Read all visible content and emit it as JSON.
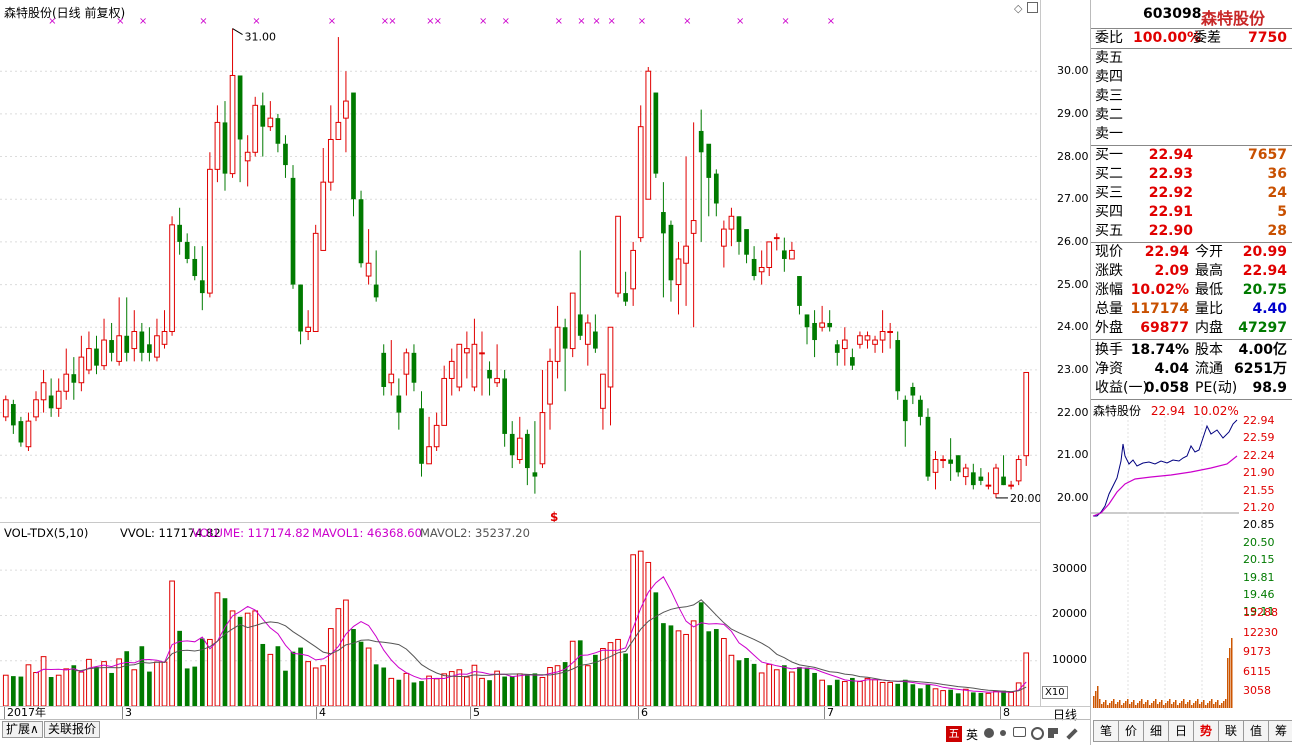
{
  "chart_title": "森特股份(日线 前复权)",
  "volume_title": {
    "name": "VOL-TDX(5,10)",
    "vvol": "VVOL: 117174.82",
    "volume": "VOLUME: 117174.82",
    "mavol1": "MAVOL1: 46368.60",
    "mavol2": "MAVOL2: 35237.20"
  },
  "colors": {
    "up": "#e00000",
    "down": "#007a00",
    "ma1": "#cc00cc",
    "ma2": "#555555"
  },
  "price_axis": [
    "30.00",
    "29.00",
    "28.00",
    "27.00",
    "26.00",
    "25.00",
    "24.00",
    "23.00",
    "22.00",
    "21.00",
    "20.00"
  ],
  "vol_axis": [
    "30000",
    "20000",
    "10000"
  ],
  "vol_axis_unit": "X10",
  "annotations": {
    "high": "31.00",
    "low": "20.00",
    "marker": "$"
  },
  "x_labels": [
    "2017年",
    "3",
    "4",
    "5",
    "6",
    "7",
    "8"
  ],
  "period_label": "日线",
  "bottom_tabs": [
    "扩展∧",
    "关联报价"
  ],
  "stock": {
    "code": "603098",
    "name": "森特股份"
  },
  "quote": {
    "webi_label": "委比",
    "webi": "100.00%",
    "weicha_label": "委差",
    "weicha": "7750",
    "sell": [
      {
        "label": "卖五",
        "price": "",
        "vol": ""
      },
      {
        "label": "卖四",
        "price": "",
        "vol": ""
      },
      {
        "label": "卖三",
        "price": "",
        "vol": ""
      },
      {
        "label": "卖二",
        "price": "",
        "vol": ""
      },
      {
        "label": "卖一",
        "price": "",
        "vol": ""
      }
    ],
    "buy": [
      {
        "label": "买一",
        "price": "22.94",
        "vol": "7657"
      },
      {
        "label": "买二",
        "price": "22.93",
        "vol": "36"
      },
      {
        "label": "买三",
        "price": "22.92",
        "vol": "24"
      },
      {
        "label": "买四",
        "price": "22.91",
        "vol": "5"
      },
      {
        "label": "买五",
        "price": "22.90",
        "vol": "28"
      }
    ],
    "stats": [
      {
        "l1": "现价",
        "v1": "22.94",
        "c1": "red",
        "l2": "今开",
        "v2": "20.99",
        "c2": "red"
      },
      {
        "l1": "涨跌",
        "v1": "2.09",
        "c1": "red",
        "l2": "最高",
        "v2": "22.94",
        "c2": "red"
      },
      {
        "l1": "涨幅",
        "v1": "10.02%",
        "c1": "red",
        "l2": "最低",
        "v2": "20.75",
        "c2": "green"
      },
      {
        "l1": "总量",
        "v1": "117174",
        "c1": "orange",
        "l2": "量比",
        "v2": "4.40",
        "c2": "blue"
      },
      {
        "l1": "外盘",
        "v1": "69877",
        "c1": "red",
        "l2": "内盘",
        "v2": "47297",
        "c2": "green"
      }
    ],
    "fund": [
      {
        "l1": "换手",
        "v1": "18.74%",
        "l2": "股本",
        "v2": "4.00亿"
      },
      {
        "l1": "净资",
        "v1": "4.04",
        "l2": "流通",
        "v2": "6251万"
      },
      {
        "l1": "收益(一)",
        "v1": "0.058",
        "l2": "PE(动)",
        "v2": "98.9"
      }
    ]
  },
  "intraday": {
    "title_name": "森特股份",
    "title_price": "22.94",
    "title_pct": "10.02%",
    "price_labels": [
      "22.94",
      "22.59",
      "22.24",
      "21.90",
      "21.55",
      "21.20",
      "20.85",
      "20.50",
      "20.15",
      "19.81",
      "19.46",
      "19.11"
    ],
    "vol_labels": [
      "15288",
      "12230",
      "9173",
      "6115",
      "3058"
    ]
  },
  "right_tabs": [
    "笔",
    "价",
    "细",
    "日",
    "势",
    "联",
    "值",
    "筹"
  ],
  "tray_icons": [
    "五",
    "英"
  ],
  "chart_data": {
    "type": "candlestick",
    "ylim": [
      19.6,
      31.2
    ],
    "vol_ylim": [
      0,
      36000
    ],
    "candles": [
      [
        21.9,
        22.3,
        22.4,
        21.8,
        6800
      ],
      [
        22.2,
        21.7,
        22.3,
        21.5,
        6600
      ],
      [
        21.8,
        21.3,
        21.9,
        21.2,
        6500
      ],
      [
        21.2,
        21.8,
        22.0,
        21.1,
        9100
      ],
      [
        21.9,
        22.3,
        22.5,
        21.8,
        7400
      ],
      [
        22.3,
        22.7,
        23.0,
        22.0,
        10900
      ],
      [
        22.4,
        22.1,
        22.8,
        21.9,
        6400
      ],
      [
        22.1,
        22.5,
        22.8,
        21.9,
        6800
      ],
      [
        22.5,
        22.9,
        23.5,
        22.3,
        8200
      ],
      [
        22.9,
        22.7,
        23.3,
        22.3,
        9000
      ],
      [
        22.7,
        23.3,
        23.8,
        22.5,
        7500
      ],
      [
        23.0,
        23.5,
        23.9,
        22.9,
        10300
      ],
      [
        23.5,
        23.1,
        23.8,
        22.9,
        8600
      ],
      [
        23.1,
        23.7,
        24.2,
        23.0,
        9800
      ],
      [
        23.7,
        23.4,
        24.1,
        23.2,
        7300
      ],
      [
        23.2,
        23.8,
        24.7,
        23.1,
        10400
      ],
      [
        23.8,
        23.4,
        24.7,
        23.2,
        12100
      ],
      [
        23.5,
        23.9,
        24.4,
        23.2,
        8000
      ],
      [
        23.9,
        23.4,
        24.1,
        23.2,
        13200
      ],
      [
        23.6,
        23.4,
        24.0,
        23.2,
        7600
      ],
      [
        23.3,
        23.8,
        24.2,
        23.2,
        9700
      ],
      [
        23.6,
        23.9,
        24.4,
        23.5,
        9700
      ],
      [
        23.9,
        26.4,
        26.6,
        23.8,
        27600
      ],
      [
        26.4,
        26.0,
        26.8,
        25.7,
        16600
      ],
      [
        26.0,
        25.6,
        26.2,
        25.5,
        8300
      ],
      [
        25.6,
        25.2,
        25.9,
        25.1,
        8700
      ],
      [
        25.1,
        24.8,
        25.9,
        24.4,
        14900
      ],
      [
        24.8,
        27.7,
        28.1,
        24.7,
        14700
      ],
      [
        27.7,
        28.8,
        29.2,
        27.4,
        25000
      ],
      [
        28.8,
        27.6,
        29.3,
        27.2,
        23800
      ],
      [
        27.6,
        29.9,
        31.0,
        27.5,
        21000
      ],
      [
        29.9,
        28.4,
        29.8,
        27.4,
        19700
      ],
      [
        27.9,
        28.1,
        28.5,
        27.3,
        20500
      ],
      [
        28.1,
        29.2,
        29.4,
        28.0,
        21000
      ],
      [
        29.2,
        28.7,
        29.5,
        28.0,
        13700
      ],
      [
        28.7,
        28.9,
        29.3,
        28.6,
        11400
      ],
      [
        28.9,
        28.3,
        29.0,
        28.1,
        13200
      ],
      [
        28.3,
        27.8,
        28.5,
        27.5,
        7800
      ],
      [
        27.5,
        25.0,
        27.8,
        24.9,
        12000
      ],
      [
        25.0,
        23.9,
        25.0,
        23.6,
        12900
      ],
      [
        23.9,
        24.0,
        24.4,
        23.7,
        9800
      ],
      [
        23.9,
        26.2,
        26.4,
        25.2,
        8400
      ],
      [
        25.8,
        27.4,
        28.2,
        26.3,
        8900
      ],
      [
        27.4,
        28.4,
        29.2,
        27.2,
        17100
      ],
      [
        28.4,
        28.8,
        30.8,
        28.4,
        21500
      ],
      [
        28.9,
        29.3,
        30.0,
        28.1,
        23400
      ],
      [
        29.5,
        27.0,
        29.4,
        26.6,
        17000
      ],
      [
        27.0,
        25.5,
        27.2,
        25.4,
        14200
      ],
      [
        25.2,
        25.5,
        26.3,
        25.0,
        12800
      ],
      [
        25.0,
        24.7,
        25.8,
        24.6,
        9200
      ],
      [
        23.4,
        22.6,
        23.6,
        22.4,
        8500
      ],
      [
        22.7,
        22.9,
        23.7,
        22.4,
        6100
      ],
      [
        22.4,
        22.0,
        22.8,
        21.6,
        5800
      ],
      [
        22.9,
        23.4,
        23.5,
        22.4,
        7200
      ],
      [
        23.4,
        22.7,
        23.6,
        22.5,
        5200
      ],
      [
        22.1,
        20.8,
        22.5,
        20.5,
        5500
      ],
      [
        20.8,
        21.2,
        21.9,
        20.9,
        6600
      ],
      [
        21.2,
        21.7,
        22.0,
        21.1,
        6000
      ],
      [
        21.7,
        22.8,
        23.1,
        21.7,
        7100
      ],
      [
        22.8,
        23.2,
        23.5,
        22.4,
        7600
      ],
      [
        22.6,
        23.6,
        23.6,
        22.5,
        8000
      ],
      [
        23.4,
        23.5,
        23.9,
        22.8,
        6400
      ],
      [
        22.6,
        23.6,
        24.2,
        22.5,
        9000
      ],
      [
        23.4,
        23.4,
        23.9,
        22.4,
        6100
      ],
      [
        23.0,
        22.8,
        23.2,
        22.4,
        5700
      ],
      [
        22.7,
        22.8,
        23.6,
        22.6,
        7700
      ],
      [
        22.8,
        21.5,
        23.0,
        21.2,
        6500
      ],
      [
        21.5,
        21.0,
        21.8,
        20.7,
        6500
      ],
      [
        20.9,
        21.4,
        21.9,
        20.8,
        7100
      ],
      [
        21.5,
        20.7,
        21.6,
        20.3,
        6800
      ],
      [
        20.6,
        20.5,
        21.8,
        20.1,
        7200
      ],
      [
        20.8,
        22.0,
        23.0,
        20.7,
        6300
      ],
      [
        22.2,
        23.2,
        23.5,
        21.6,
        8500
      ],
      [
        23.2,
        24.0,
        24.5,
        22.8,
        8900
      ],
      [
        24.0,
        23.5,
        24.2,
        22.5,
        9700
      ],
      [
        23.5,
        24.8,
        24.8,
        23.3,
        14300
      ],
      [
        24.3,
        23.8,
        25.8,
        23.7,
        14500
      ],
      [
        23.6,
        24.1,
        24.3,
        23.1,
        8900
      ],
      [
        23.9,
        23.5,
        24.3,
        23.4,
        11300
      ],
      [
        22.1,
        22.9,
        22.9,
        21.6,
        12700
      ],
      [
        22.6,
        24.0,
        24.0,
        21.7,
        14000
      ],
      [
        24.8,
        26.6,
        26.6,
        24.7,
        14700
      ],
      [
        24.8,
        24.6,
        25.3,
        24.5,
        11600
      ],
      [
        24.9,
        25.8,
        26.0,
        24.5,
        33400
      ],
      [
        26.1,
        28.7,
        29.2,
        26.0,
        34200
      ],
      [
        27.0,
        30.0,
        30.1,
        27.0,
        31700
      ],
      [
        29.5,
        27.6,
        29.5,
        27.5,
        25100
      ],
      [
        26.7,
        26.2,
        27.4,
        24.7,
        18300
      ],
      [
        26.4,
        25.1,
        26.5,
        24.6,
        17800
      ],
      [
        25.0,
        25.6,
        26.0,
        24.3,
        16600
      ],
      [
        25.5,
        25.9,
        28.0,
        24.5,
        15800
      ],
      [
        26.2,
        26.5,
        28.8,
        24.0,
        18800
      ],
      [
        28.6,
        28.1,
        29.1,
        26.0,
        22900
      ],
      [
        28.3,
        27.5,
        28.0,
        26.6,
        16500
      ],
      [
        27.6,
        26.9,
        27.7,
        26.6,
        17000
      ],
      [
        25.9,
        26.3,
        26.5,
        25.4,
        14900
      ],
      [
        26.3,
        26.6,
        26.8,
        25.9,
        11200
      ],
      [
        26.6,
        26.0,
        26.6,
        25.7,
        10100
      ],
      [
        26.3,
        25.7,
        26.2,
        25.5,
        10600
      ],
      [
        25.6,
        25.2,
        25.9,
        25.1,
        9300
      ],
      [
        25.3,
        25.4,
        25.8,
        25.0,
        7300
      ],
      [
        25.4,
        26.0,
        26.0,
        25.2,
        9200
      ],
      [
        26.1,
        26.1,
        26.2,
        25.8,
        8000
      ],
      [
        25.8,
        25.6,
        26.1,
        25.3,
        9000
      ],
      [
        25.6,
        25.8,
        26.0,
        25.6,
        7500
      ],
      [
        25.2,
        24.5,
        25.2,
        24.3,
        8600
      ],
      [
        24.3,
        24.0,
        24.3,
        23.6,
        8500
      ],
      [
        24.1,
        23.7,
        24.4,
        23.3,
        7300
      ],
      [
        24.0,
        24.1,
        24.5,
        23.9,
        5700
      ],
      [
        24.1,
        24.0,
        24.4,
        23.9,
        4600
      ],
      [
        23.6,
        23.4,
        23.7,
        23.1,
        5800
      ],
      [
        23.5,
        23.7,
        24.0,
        23.1,
        5400
      ],
      [
        23.3,
        23.1,
        23.5,
        23.0,
        6200
      ],
      [
        23.6,
        23.8,
        23.9,
        23.5,
        5400
      ],
      [
        23.7,
        23.8,
        23.9,
        23.5,
        6100
      ],
      [
        23.6,
        23.7,
        23.8,
        23.4,
        5800
      ],
      [
        23.7,
        23.9,
        24.4,
        23.4,
        5200
      ],
      [
        23.9,
        23.9,
        24.1,
        23.5,
        5200
      ],
      [
        23.7,
        22.5,
        23.9,
        22.3,
        4900
      ],
      [
        22.3,
        21.8,
        22.4,
        21.2,
        5800
      ],
      [
        22.6,
        22.4,
        22.7,
        22.2,
        4800
      ],
      [
        22.3,
        21.9,
        22.4,
        21.7,
        3900
      ],
      [
        21.9,
        20.5,
        22.1,
        20.4,
        4700
      ],
      [
        20.6,
        20.9,
        21.1,
        20.2,
        3800
      ],
      [
        20.9,
        20.9,
        21.0,
        20.7,
        3400
      ],
      [
        20.9,
        20.8,
        21.4,
        20.4,
        3600
      ],
      [
        21.0,
        20.6,
        21.0,
        20.5,
        2800
      ],
      [
        20.5,
        20.7,
        20.8,
        20.3,
        3700
      ],
      [
        20.6,
        20.3,
        20.8,
        20.2,
        3000
      ],
      [
        20.5,
        20.4,
        20.7,
        20.3,
        2900
      ],
      [
        20.3,
        20.3,
        20.6,
        20.2,
        2800
      ],
      [
        20.1,
        20.7,
        20.8,
        20.0,
        3300
      ],
      [
        20.5,
        20.3,
        21.0,
        20.3,
        3400
      ],
      [
        20.3,
        20.3,
        20.4,
        20.2,
        3000
      ],
      [
        20.4,
        20.9,
        21.0,
        20.3,
        5100
      ],
      [
        20.99,
        22.94,
        22.94,
        20.75,
        11717
      ]
    ],
    "x_dates": [
      "2017年",
      "3",
      "4",
      "5",
      "6",
      "7",
      "8"
    ]
  }
}
